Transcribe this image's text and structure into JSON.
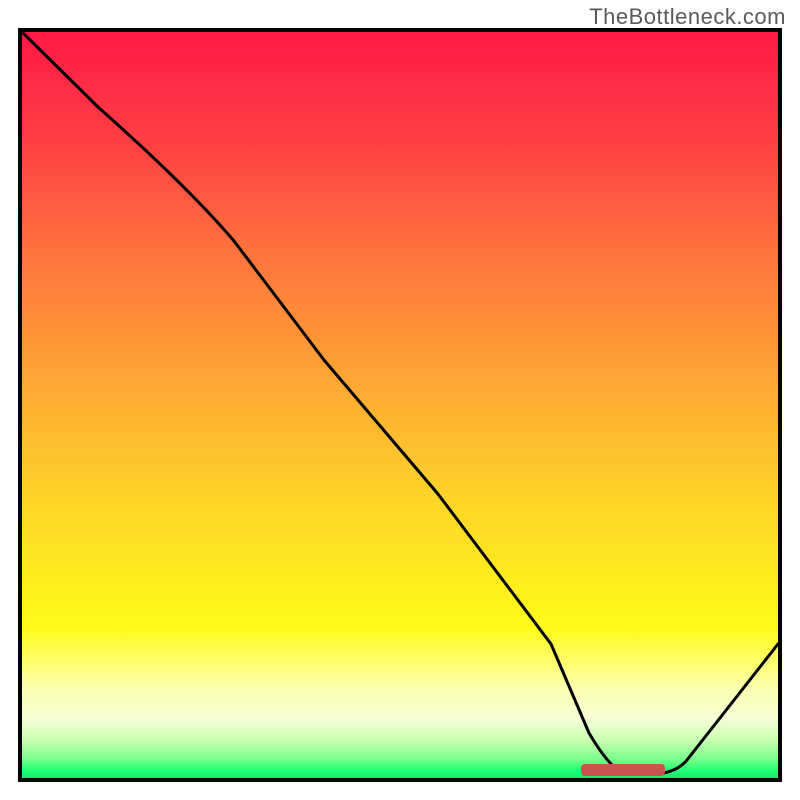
{
  "watermark": "TheBottleneck.com",
  "chart_data": {
    "type": "line",
    "title": "",
    "xlabel": "",
    "ylabel": "",
    "xlim": [
      0,
      100
    ],
    "ylim": [
      0,
      100
    ],
    "grid": false,
    "series": [
      {
        "name": "bottleneck-curve",
        "x": [
          0,
          10,
          22,
          28,
          40,
          55,
          70,
          75,
          80,
          84,
          88,
          100
        ],
        "values": [
          100,
          90,
          78,
          72,
          56,
          38,
          18,
          6,
          0,
          0,
          2,
          18
        ]
      }
    ],
    "annotations": [
      {
        "name": "optimal-marker",
        "x_start": 74,
        "x_end": 85,
        "y": 0.5,
        "color": "#c9544e"
      }
    ],
    "background_gradient": {
      "from": "#ff1a44",
      "to": "#15e86b",
      "type": "vertical-rainbow"
    }
  }
}
